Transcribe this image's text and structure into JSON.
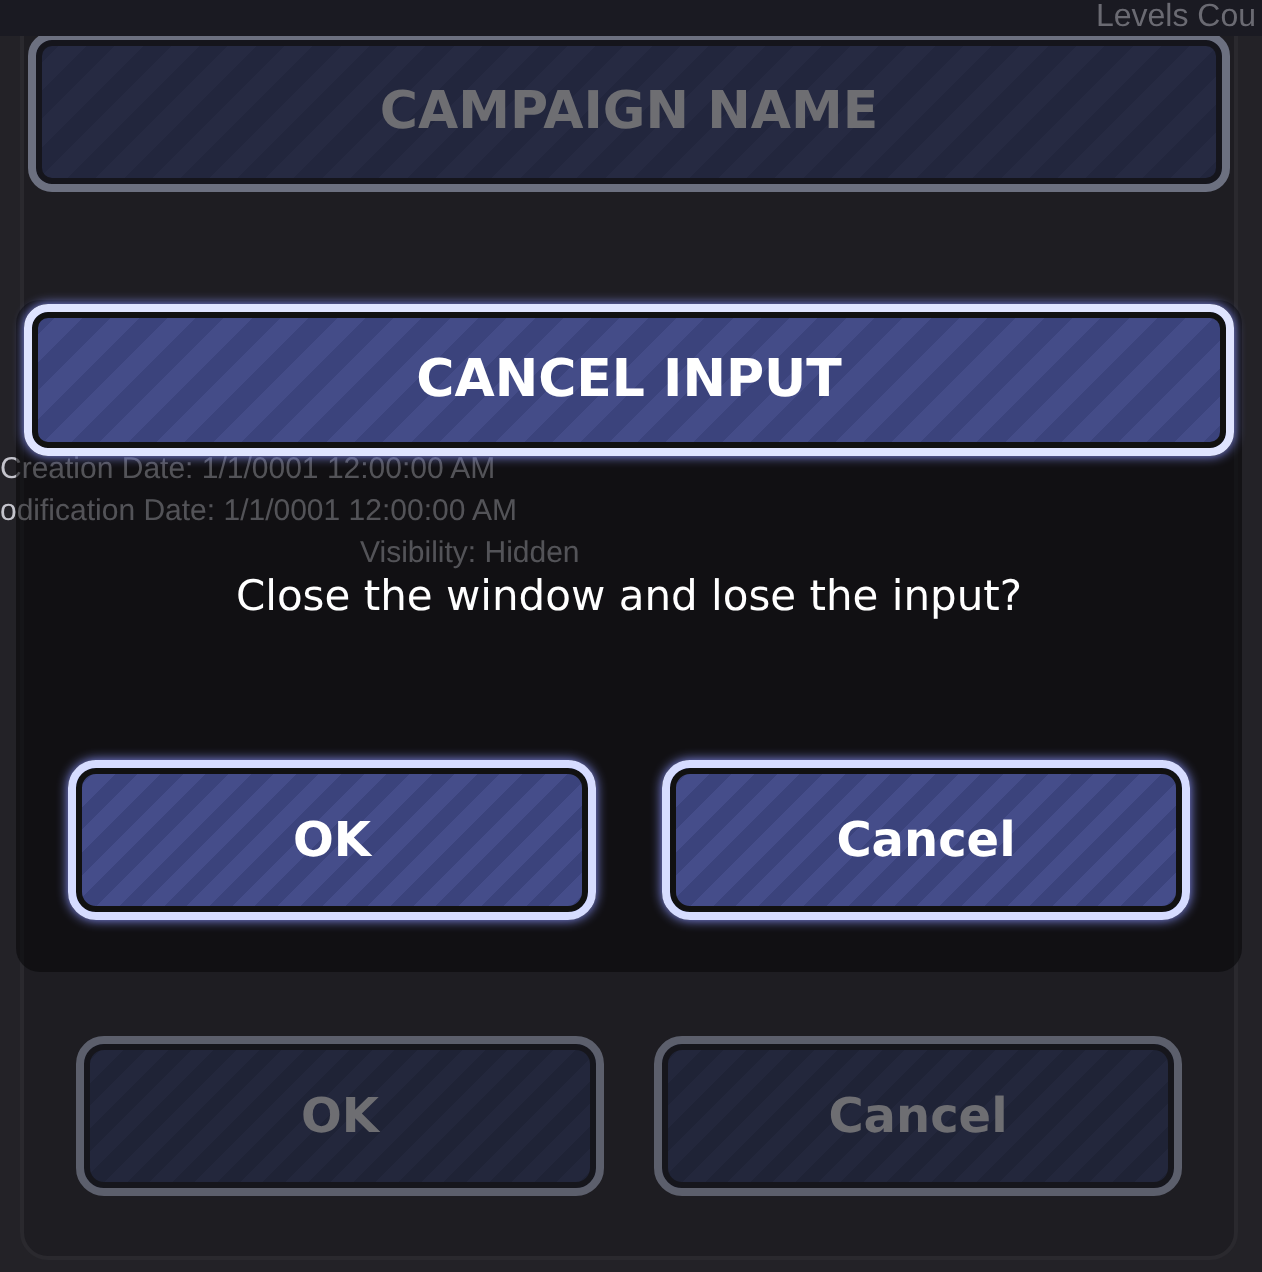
{
  "background": {
    "corner_label": "Levels Cou",
    "title": "CAMPAIGN NAME",
    "info_lines": [
      "Creation Date: 1/1/0001 12:00:00 AM",
      "odification Date: 1/1/0001 12:00:00 AM",
      "Visibility: Hidden"
    ],
    "buttons": [
      {
        "label": "OK",
        "disabled": true
      },
      {
        "label": "Cancel",
        "disabled": true
      }
    ]
  },
  "dialog": {
    "title": "CANCEL INPUT",
    "message": "Close the window and lose the input?",
    "buttons": [
      {
        "label": "OK",
        "disabled": false
      },
      {
        "label": "Cancel",
        "disabled": false
      }
    ]
  }
}
